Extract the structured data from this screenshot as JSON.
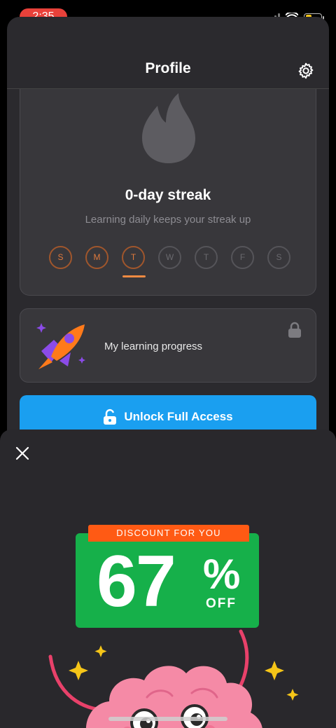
{
  "status_bar": {
    "time": "2:35"
  },
  "header": {
    "title": "Profile"
  },
  "streak": {
    "title": "0-day streak",
    "subtitle": "Learning daily keeps your streak up",
    "days": [
      "S",
      "M",
      "T",
      "W",
      "T",
      "F",
      "S"
    ],
    "today_index": 2
  },
  "progress_card": {
    "label": "My learning progress"
  },
  "unlock": {
    "label": "Unlock Full Access"
  },
  "offer": {
    "tag": "DISCOUNT FOR YOU",
    "number": "67",
    "percent": "%",
    "off": "OFF"
  },
  "colors": {
    "accent_blue": "#1a9ff0",
    "discount_green": "#16b04a",
    "discount_orange": "#ff5a14",
    "streak_orange": "#e07a3d",
    "status_red": "#e8413a"
  }
}
